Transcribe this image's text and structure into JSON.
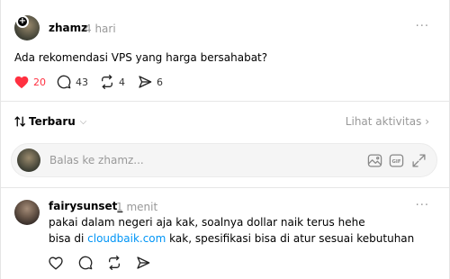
{
  "post": {
    "username": "zhamz",
    "time": "4 hari",
    "more": "···",
    "text": "Ada rekomendasi VPS yang harga bersahabat?",
    "actions": {
      "likes": "20",
      "comments": "43",
      "reposts": "4",
      "shares": "6"
    },
    "icons": {
      "like": "heart-filled-icon",
      "comment": "comment-icon",
      "repost": "repost-icon",
      "share": "share-icon",
      "follow": "plus-icon"
    },
    "colors": {
      "like": "#ff3040"
    }
  },
  "sort": {
    "label": "Terbaru",
    "activity_link": "Lihat aktivitas ›"
  },
  "reply_box": {
    "placeholder": "Balas ke zhamz...",
    "icons": [
      "image-icon",
      "gif-icon",
      "expand-icon"
    ]
  },
  "comment": {
    "username": "fairysunset_",
    "time": "1 menit",
    "more": "···",
    "line1": "pakai dalam negeri aja kak, soalnya dollar naik terus hehe",
    "line2_prefix": "bisa di ",
    "line2_link": "cloudbaik.com",
    "line2_suffix": " kak, spesifikasi bisa di atur sesuai kebutuhan",
    "link_color": "#0095f6",
    "icons": [
      "heart-icon",
      "comment-icon",
      "repost-icon",
      "share-icon"
    ]
  }
}
